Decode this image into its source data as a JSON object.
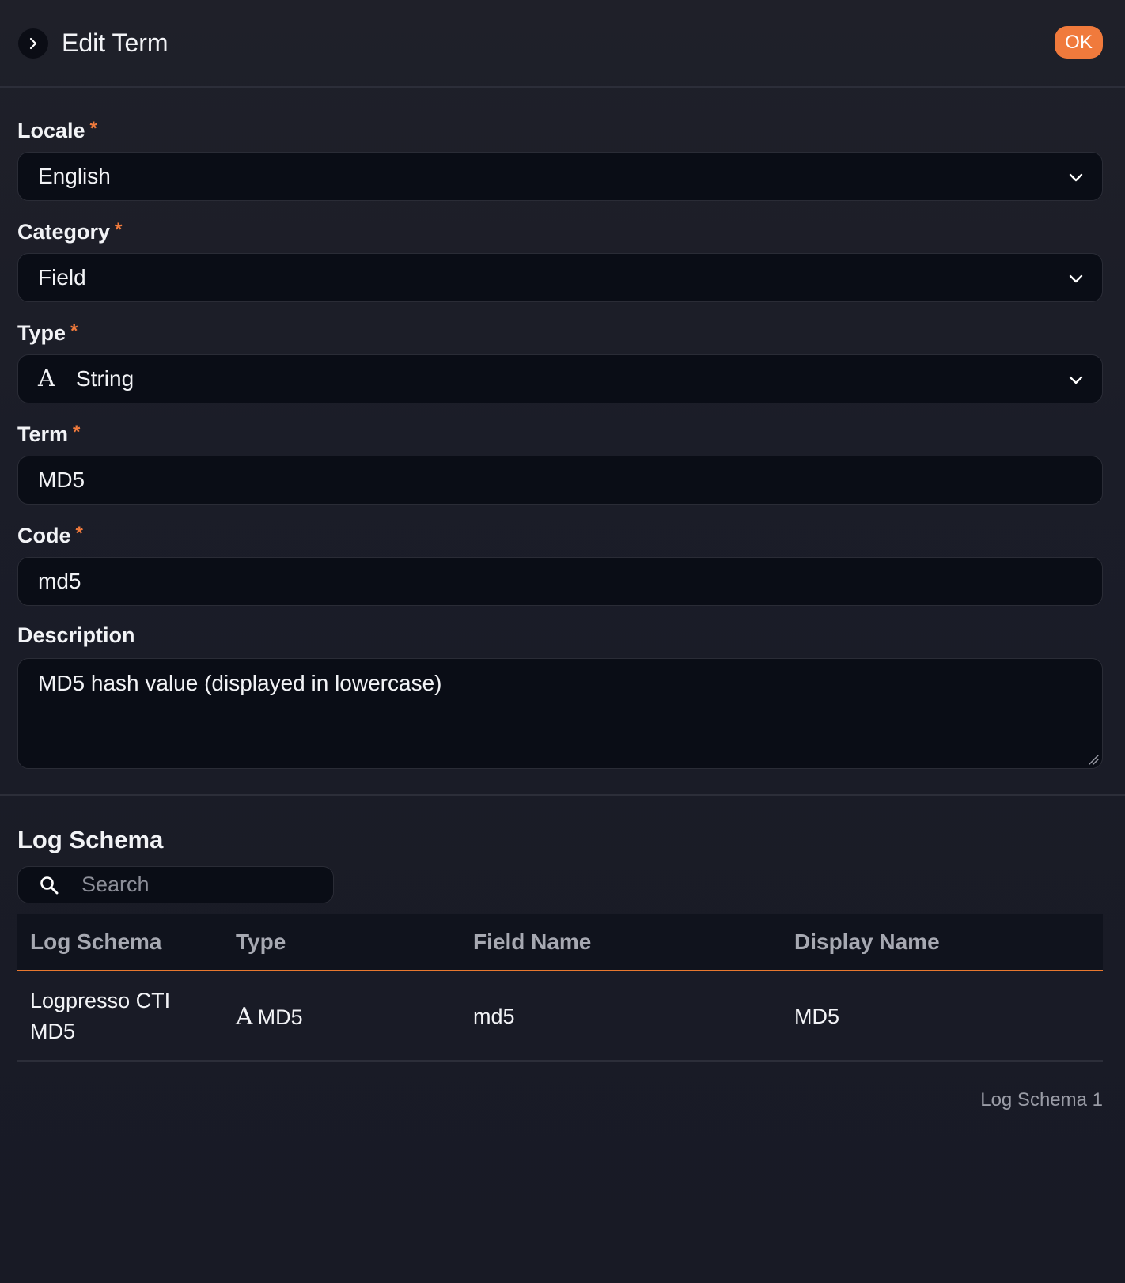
{
  "header": {
    "title": "Edit Term",
    "ok_label": "OK"
  },
  "form": {
    "locale": {
      "label": "Locale",
      "required": "*",
      "value": "English"
    },
    "category": {
      "label": "Category",
      "required": "*",
      "value": "Field"
    },
    "type": {
      "label": "Type",
      "required": "*",
      "icon_glyph": "A",
      "value": "String"
    },
    "term": {
      "label": "Term",
      "required": "*",
      "value": "MD5"
    },
    "code": {
      "label": "Code",
      "required": "*",
      "value": "md5"
    },
    "description": {
      "label": "Description",
      "value": "MD5 hash value (displayed in lowercase)"
    }
  },
  "log_schema": {
    "title": "Log Schema",
    "search_placeholder": "Search",
    "columns": [
      "Log Schema",
      "Type",
      "Field Name",
      "Display Name"
    ],
    "rows": [
      {
        "log_schema_line1": "Logpresso CTI",
        "log_schema_line2": "MD5",
        "type_icon": "A",
        "type": "MD5",
        "field_name": "md5",
        "display_name": "MD5"
      }
    ],
    "count_label": "Log Schema 1"
  },
  "colors": {
    "accent": "#f07a3c",
    "background": "#1a1c27",
    "field_bg": "#0a0d16"
  }
}
